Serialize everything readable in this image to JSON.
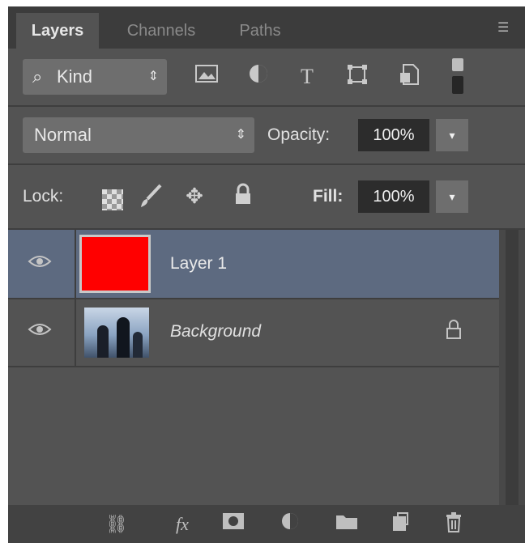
{
  "tabs": [
    {
      "label": "Layers"
    },
    {
      "label": "Channels"
    },
    {
      "label": "Paths"
    }
  ],
  "filter": {
    "kind_label": "Kind",
    "icons": [
      "image-filter-icon",
      "adjustment-filter-icon",
      "type-filter-icon",
      "shape-filter-icon",
      "smart-object-filter-icon"
    ],
    "type_glyph": "T"
  },
  "blend": {
    "mode": "Normal",
    "opacity_label": "Opacity:",
    "opacity_value": "100%"
  },
  "lock": {
    "label": "Lock:",
    "fill_label": "Fill:",
    "fill_value": "100%"
  },
  "layers": [
    {
      "name": "Layer 1",
      "selected": true,
      "thumb_color": "#ff0000"
    },
    {
      "name": "Background",
      "selected": false,
      "locked": true
    }
  ],
  "footer_icons": [
    "link-layers-icon",
    "fx-icon",
    "layer-mask-icon",
    "adjustment-layer-icon",
    "new-group-icon",
    "new-layer-icon",
    "trash-icon"
  ],
  "footer": {
    "fx_label": "fx"
  },
  "colors": {
    "panel": "#535353",
    "tabbar": "#3c3c3c",
    "selection": "#5d6a80",
    "layer1_fill": "#ff0000"
  }
}
